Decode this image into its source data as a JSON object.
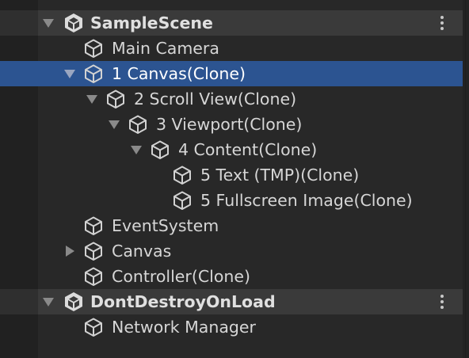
{
  "hierarchy": {
    "scenes": [
      {
        "name": "SampleScene",
        "icon": "unity-scene-icon",
        "expanded": true,
        "menu_icon": "kebab-menu-icon",
        "items": [
          {
            "label": "Main Camera",
            "depth": 0,
            "toggle": "none",
            "icon": "cube-icon",
            "selected": false
          },
          {
            "label": "1 Canvas(Clone)",
            "depth": 0,
            "toggle": "expanded",
            "icon": "cube-icon",
            "selected": true
          },
          {
            "label": "2 Scroll View(Clone)",
            "depth": 1,
            "toggle": "expanded",
            "icon": "cube-icon",
            "selected": false
          },
          {
            "label": "3 Viewport(Clone)",
            "depth": 2,
            "toggle": "expanded",
            "icon": "cube-icon",
            "selected": false
          },
          {
            "label": "4 Content(Clone)",
            "depth": 3,
            "toggle": "expanded",
            "icon": "cube-icon",
            "selected": false
          },
          {
            "label": "5 Text (TMP)(Clone)",
            "depth": 4,
            "toggle": "none",
            "icon": "cube-icon",
            "selected": false
          },
          {
            "label": "5 Fullscreen Image(Clone)",
            "depth": 4,
            "toggle": "none",
            "icon": "cube-icon",
            "selected": false
          },
          {
            "label": "EventSystem",
            "depth": 0,
            "toggle": "none",
            "icon": "cube-icon",
            "selected": false
          },
          {
            "label": "Canvas",
            "depth": 0,
            "toggle": "collapsed",
            "icon": "cube-icon",
            "selected": false
          },
          {
            "label": "Controller(Clone)",
            "depth": 0,
            "toggle": "none",
            "icon": "cube-icon",
            "selected": false
          }
        ]
      },
      {
        "name": "DontDestroyOnLoad",
        "icon": "unity-scene-icon",
        "expanded": true,
        "menu_icon": "kebab-menu-icon",
        "items": [
          {
            "label": "Network Manager",
            "depth": 0,
            "toggle": "none",
            "icon": "cube-icon",
            "selected": false
          }
        ]
      }
    ]
  },
  "colors": {
    "selection": "#2c5491",
    "scene_header": "#3a3a3a",
    "background": "#282828",
    "text": "#d6d6d6"
  }
}
